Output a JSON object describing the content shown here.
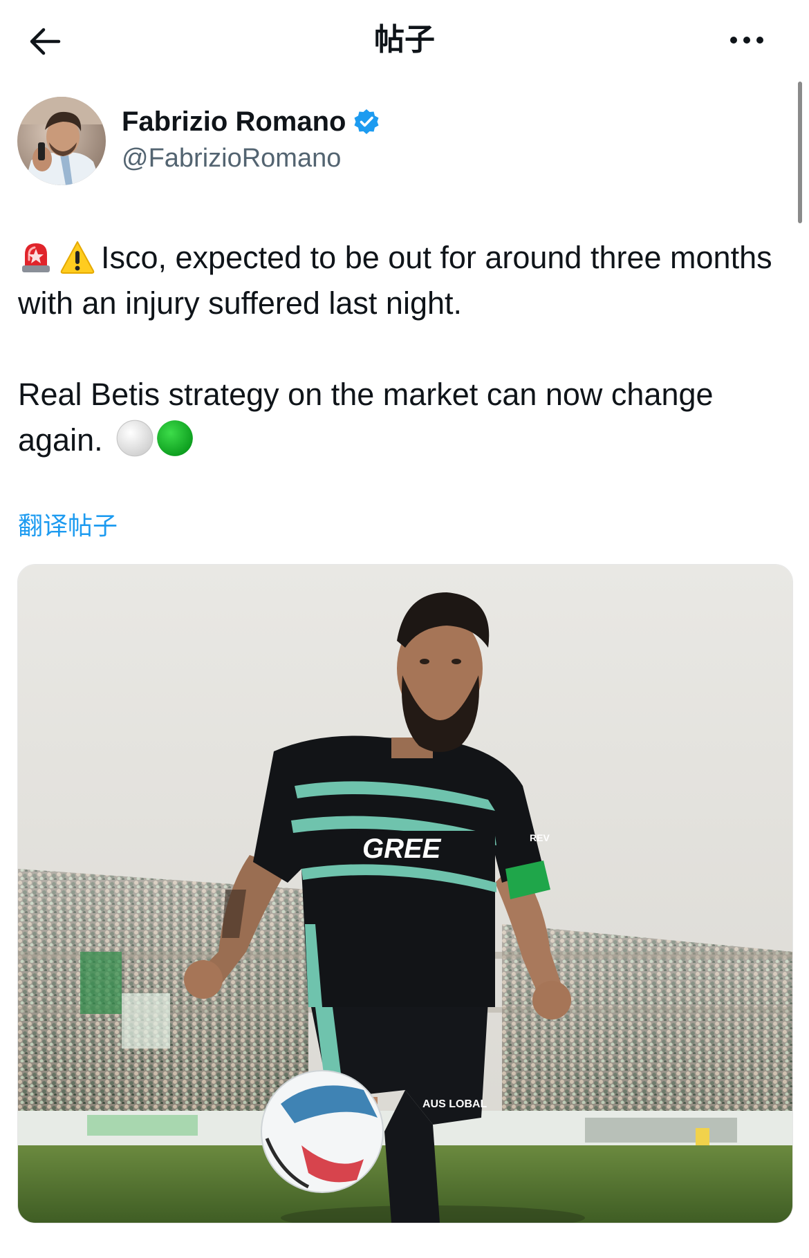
{
  "header": {
    "title": "帖子",
    "back_icon": "arrow-left-icon",
    "more_icon": "more-horizontal-icon"
  },
  "author": {
    "name": "Fabrizio Romano",
    "handle": "@FabrizioRomano",
    "verified": true,
    "verified_color": "#1d9bf0"
  },
  "post": {
    "paragraph1_emojis": [
      "siren-emoji",
      "warning-emoji"
    ],
    "paragraph1": "Isco, expected to be out for around three months with an injury suffered last night.",
    "paragraph2": "Real Betis strategy on the market can now change again.",
    "paragraph2_emojis": [
      "white-circle-emoji",
      "green-circle-emoji"
    ],
    "translate_label": "翻译帖子"
  },
  "media": {
    "sponsor_text": "GREE",
    "sleeve_text": "REV",
    "shorts_text": "AUS LOBAL"
  },
  "colors": {
    "accent": "#1d9bf0",
    "text": "#0f1419",
    "secondary": "#536471"
  }
}
